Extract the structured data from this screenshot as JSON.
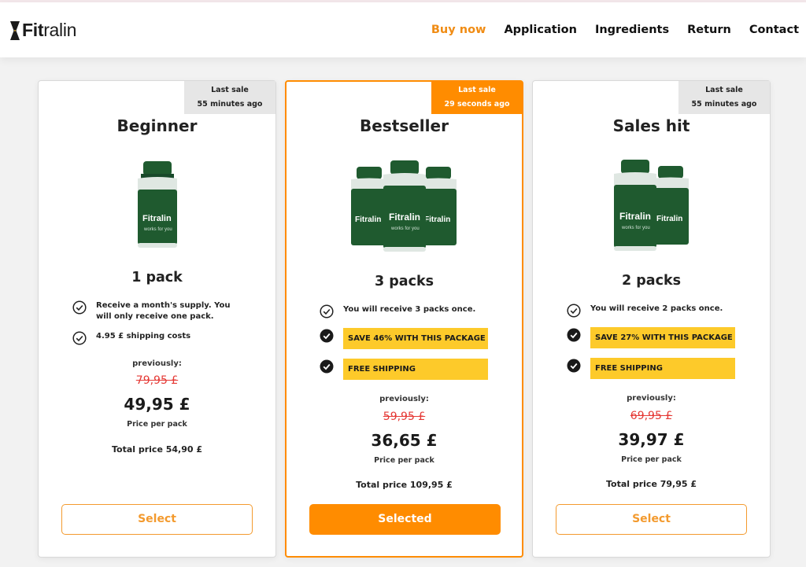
{
  "brand": {
    "logo_bold": "Fit",
    "logo_light": "ralin"
  },
  "nav": [
    {
      "label": "Buy now"
    },
    {
      "label": "Application"
    },
    {
      "label": "Ingredients"
    },
    {
      "label": "Return"
    },
    {
      "label": "Contact"
    }
  ],
  "colors": {
    "accent": "#ff8c00",
    "highlight": "#fdca2a",
    "old_price": "#e53935"
  },
  "cards": [
    {
      "badge_line1": "Last sale",
      "badge_line2": "55 minutes ago",
      "title": "Beginner",
      "bottle_count": 1,
      "quantity": "1 pack",
      "features": [
        "Receive a month's supply. You will only receive one pack.",
        "4.95 £ shipping costs"
      ],
      "previously_label": "previously:",
      "old_price": "79,95 £",
      "price": "49,95 £",
      "price_per_pack_label": "Price per pack",
      "total": "Total price 54,90 £",
      "button": "Select"
    },
    {
      "badge_line1": "Last sale",
      "badge_line2": "29 seconds ago",
      "title": "Bestseller",
      "bottle_count": 3,
      "quantity": "3 packs",
      "features": [
        "You will receive 3 packs once.",
        "SAVE 46% WITH THIS PACKAGE",
        "FREE SHIPPING"
      ],
      "previously_label": "previously:",
      "old_price": "59,95 £",
      "price": "36,65 £",
      "price_per_pack_label": "Price per pack",
      "total": "Total price 109,95 £",
      "button": "Selected"
    },
    {
      "badge_line1": "Last sale",
      "badge_line2": "55 minutes ago",
      "title": "Sales hit",
      "bottle_count": 2,
      "quantity": "2 packs",
      "features": [
        "You will receive 2 packs once.",
        "SAVE 27% WITH THIS PACKAGE",
        "FREE SHIPPING"
      ],
      "previously_label": "previously:",
      "old_price": "69,95 £",
      "price": "39,97 £",
      "price_per_pack_label": "Price per pack",
      "total": "Total price 79,95 £",
      "button": "Select"
    }
  ]
}
